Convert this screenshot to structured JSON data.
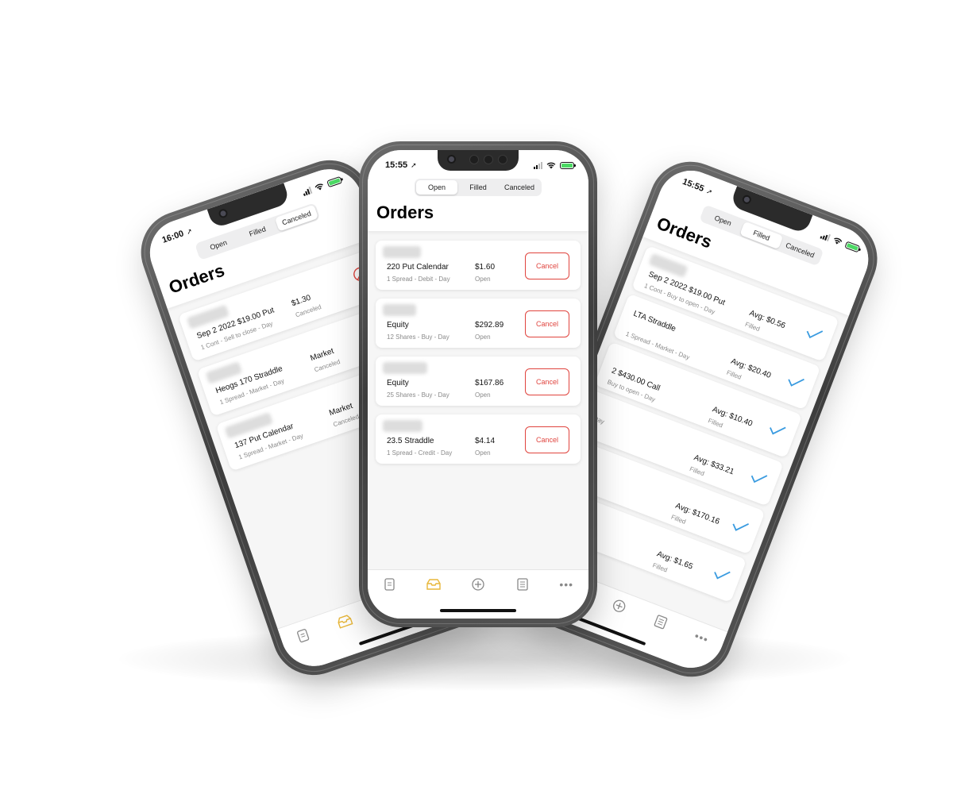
{
  "tabs": [
    "Open",
    "Filled",
    "Canceled"
  ],
  "title": "Orders",
  "action_label": "Cancel",
  "accent_color": "#e0443e",
  "brand_color": "#e8b73a",
  "check_color": "#3a9be0",
  "tab_icons": [
    "watchlist-icon",
    "orders-icon",
    "new-order-icon",
    "positions-icon",
    "more-icon"
  ],
  "phone_left": {
    "time": "16:00",
    "active_tab": 2,
    "orders": [
      {
        "name": "Sep 2 2022 $19.00 Put",
        "sub": "1 Cont - Sell to close - Day",
        "price": "$1.30",
        "state": "Canceled"
      },
      {
        "name": "Heogs 170 Straddle",
        "sub": "1 Spread - Market - Day",
        "price": "Market",
        "state": "Canceled"
      },
      {
        "name": "137 Put Calendar",
        "sub": "1 Spread - Market - Day",
        "price": "Market",
        "state": "Canceled"
      }
    ]
  },
  "phone_center": {
    "time": "15:55",
    "active_tab": 0,
    "orders": [
      {
        "name": "220 Put Calendar",
        "sub": "1 Spread - Debit - Day",
        "price": "$1.60",
        "state": "Open"
      },
      {
        "name": "Equity",
        "sub": "12 Shares - Buy - Day",
        "price": "$292.89",
        "state": "Open"
      },
      {
        "name": "Equity",
        "sub": "25 Shares - Buy - Day",
        "price": "$167.86",
        "state": "Open"
      },
      {
        "name": "23.5 Straddle",
        "sub": "1 Spread - Credit - Day",
        "price": "$4.14",
        "state": "Open"
      }
    ]
  },
  "phone_right": {
    "time": "15:55",
    "active_tab": 1,
    "orders": [
      {
        "name": "Sep 2 2022 $19.00 Put",
        "sub": "1 Cont - Buy to open - Day",
        "price": "Avg: $0.56",
        "state": "Filled"
      },
      {
        "name": "LTA Straddle",
        "sub": "1 Spread - Market - Day",
        "price": "Avg: $20.40",
        "state": "Filled"
      },
      {
        "name": "2 $430.00 Call",
        "sub": "Buy to open - Day",
        "price": "Avg: $10.40",
        "state": "Filled"
      },
      {
        "name": "",
        "sub": "Day",
        "price": "Avg: $33.21",
        "state": "Filled"
      },
      {
        "name": "",
        "sub": "",
        "price": "Avg: $170.16",
        "state": "Filled"
      },
      {
        "name": "",
        "sub": "",
        "price": "Avg: $1.65",
        "state": "Filled"
      }
    ]
  }
}
